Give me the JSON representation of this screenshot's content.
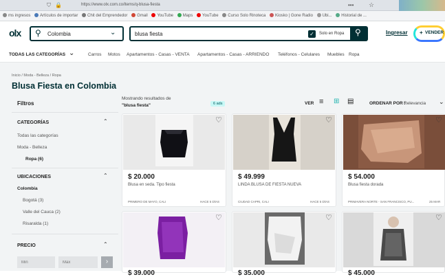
{
  "browser": {
    "url": "https://www.olx.com.co/items/q-blusa-fiesta",
    "bookmarks": [
      "ms ingresos",
      "Artículos de importar",
      "Chit del Emprendedor",
      "Gmail",
      "YouTube",
      "Maps",
      "YouTube",
      "Curso Solo Rinoteca",
      "Kiosko | Gone Radio",
      "Ubi...",
      "Historial de ..."
    ]
  },
  "header": {
    "logo": "olx",
    "location": "Colombia",
    "search_value": "blusa fiesta",
    "nearby_label": "Solo en Ropa",
    "login": "Ingresar",
    "sell": "VENDER",
    "sell_plus": "+"
  },
  "nav": {
    "all_categories": "TODAS LAS CATEGORÍAS",
    "items": [
      "Carros",
      "Motos",
      "Apartamentos - Casas - VENTA",
      "Apartamentos - Casas - ARRIENDO",
      "Teléfonos - Celulares",
      "Muebles",
      "Ropa"
    ]
  },
  "breadcrumb": "Inicio / Moda - Belleza / Ropa",
  "page_title": "Blusa Fiesta en Colombia",
  "filters": {
    "title": "Filtros",
    "categories_title": "CATEGORÍAS",
    "categories": [
      "Todas las categorías",
      "Moda - Belleza"
    ],
    "active_category": "Ropa (6)",
    "locations_title": "UBICACIONES",
    "location_country": "Colombia",
    "locations": [
      "Bogotá (3)",
      "Valle del Cauca (2)",
      "Risaralda (1)"
    ],
    "price_title": "PRECIO",
    "min_placeholder": "Min",
    "max_placeholder": "Max",
    "go": "›"
  },
  "results": {
    "showing": "Mostrando resultados de",
    "query": "\"blusa fiesta\"",
    "count_badge": "6 ads",
    "view_label": "VER",
    "order_label": "ORDENAR POR :",
    "order_value": "Relevancia"
  },
  "products": [
    {
      "price": "$ 20.000",
      "title": "Blusa en seda. Tipo fiesta",
      "location": "Primero de Mayo, Cali",
      "date": "Hace 5 días",
      "colors": [
        "#e9e9e9",
        "#101015"
      ]
    },
    {
      "price": "$ 49.999",
      "title": "LINDA BLUSA DE FIESTA NUEVA",
      "location": "Ciudad Capri, Cali",
      "date": "Hace 5 días",
      "colors": [
        "#d6d1c9",
        "#161616"
      ]
    },
    {
      "price": "$ 54.000",
      "title": "Blusa fiesta dorada",
      "location": "Primavera Norte - San Francisco, Pu...",
      "date": "25 mar",
      "colors": [
        "#7a4e3a",
        "#c8967a"
      ]
    },
    {
      "price": "$ 39.000",
      "title": "",
      "location": "",
      "date": "",
      "colors": [
        "#f3f0f5",
        "#7b1fa2"
      ]
    },
    {
      "price": "$ 35.000",
      "title": "",
      "location": "",
      "date": "",
      "colors": [
        "#6a6a6a",
        "#f2f2f2"
      ]
    },
    {
      "price": "$ 45.000",
      "title": "",
      "location": "",
      "date": "",
      "colors": [
        "#d9d9d9",
        "#4a4a4a"
      ]
    }
  ]
}
